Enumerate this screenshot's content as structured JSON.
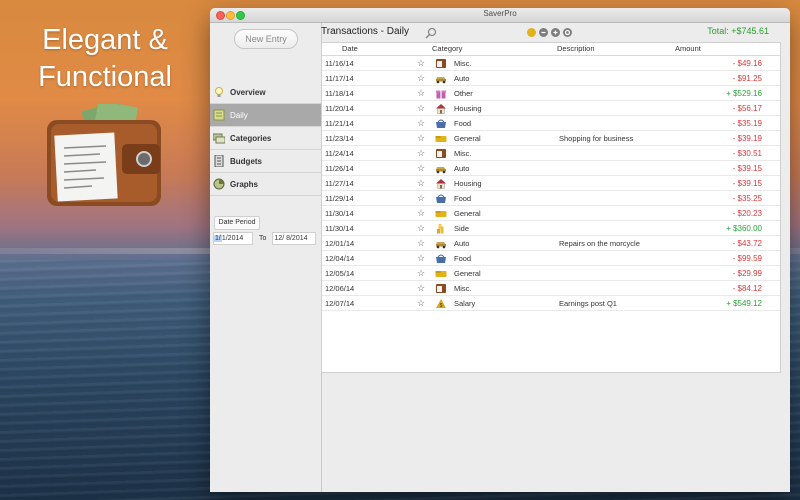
{
  "promo": {
    "line1": "Elegant &",
    "line2": "Functional"
  },
  "window": {
    "title": "SaverPro"
  },
  "sidebar": {
    "new_entry_label": "New Entry",
    "items": [
      {
        "label": "Overview",
        "icon": "lightbulb-icon",
        "active": false
      },
      {
        "label": "Daily",
        "icon": "notepad-icon",
        "active": true
      },
      {
        "label": "Categories",
        "icon": "categories-icon",
        "active": false
      },
      {
        "label": "Budgets",
        "icon": "ledger-icon",
        "active": false
      },
      {
        "label": "Graphs",
        "icon": "graph-icon",
        "active": false
      }
    ],
    "date_period_label": "Date Period",
    "date_from_highlight": "1/",
    "date_from_rest": " 1/2014",
    "date_to_label": "To",
    "date_to": "12/  8/2014"
  },
  "header": {
    "title": "Transactions  - Daily",
    "total": "Total: +$745.61",
    "buttons": [
      "yellow-circle",
      "minus-circle",
      "plus-circle",
      "gear-circle"
    ]
  },
  "table": {
    "columns": [
      "Date",
      "Category",
      "Description",
      "Amount"
    ],
    "rows": [
      {
        "date": "11/16/14",
        "category": "Misc.",
        "description": "",
        "amount": "- $49.16",
        "type": "neg",
        "icon": "misc"
      },
      {
        "date": "11/17/14",
        "category": "Auto",
        "description": "",
        "amount": "- $91.25",
        "type": "neg",
        "icon": "auto"
      },
      {
        "date": "11/18/14",
        "category": "Other",
        "description": "",
        "amount": "+ $529.16",
        "type": "pos",
        "icon": "other"
      },
      {
        "date": "11/20/14",
        "category": "Housing",
        "description": "",
        "amount": "- $56.17",
        "type": "neg",
        "icon": "housing"
      },
      {
        "date": "11/21/14",
        "category": "Food",
        "description": "",
        "amount": "- $35.19",
        "type": "neg",
        "icon": "food"
      },
      {
        "date": "11/23/14",
        "category": "General",
        "description": "Shopping for business",
        "amount": "- $39.19",
        "type": "neg",
        "icon": "general"
      },
      {
        "date": "11/24/14",
        "category": "Misc.",
        "description": "",
        "amount": "- $30.51",
        "type": "neg",
        "icon": "misc"
      },
      {
        "date": "11/26/14",
        "category": "Auto",
        "description": "",
        "amount": "- $39.15",
        "type": "neg",
        "icon": "auto"
      },
      {
        "date": "11/27/14",
        "category": "Housing",
        "description": "",
        "amount": "- $39.15",
        "type": "neg",
        "icon": "housing"
      },
      {
        "date": "11/29/14",
        "category": "Food",
        "description": "",
        "amount": "- $35.25",
        "type": "neg",
        "icon": "food"
      },
      {
        "date": "11/30/14",
        "category": "General",
        "description": "",
        "amount": "- $20.23",
        "type": "neg",
        "icon": "general"
      },
      {
        "date": "11/30/14",
        "category": "Side",
        "description": "",
        "amount": "+ $360.00",
        "type": "pos",
        "icon": "side"
      },
      {
        "date": "12/01/14",
        "category": "Auto",
        "description": "Repairs on the morcycle",
        "amount": "- $43.72",
        "type": "neg",
        "icon": "auto"
      },
      {
        "date": "12/04/14",
        "category": "Food",
        "description": "",
        "amount": "- $99.59",
        "type": "neg",
        "icon": "food"
      },
      {
        "date": "12/05/14",
        "category": "General",
        "description": "",
        "amount": "- $29.99",
        "type": "neg",
        "icon": "general"
      },
      {
        "date": "12/06/14",
        "category": "Misc.",
        "description": "",
        "amount": "- $84.12",
        "type": "neg",
        "icon": "misc"
      },
      {
        "date": "12/07/14",
        "category": "Salary",
        "description": "Earnings post Q1",
        "amount": "+ $549.12",
        "type": "pos",
        "icon": "salary"
      }
    ]
  },
  "colors": {
    "negative": "#e0373a",
    "positive": "#2aa339",
    "active_nav": "#a9a9a9"
  }
}
